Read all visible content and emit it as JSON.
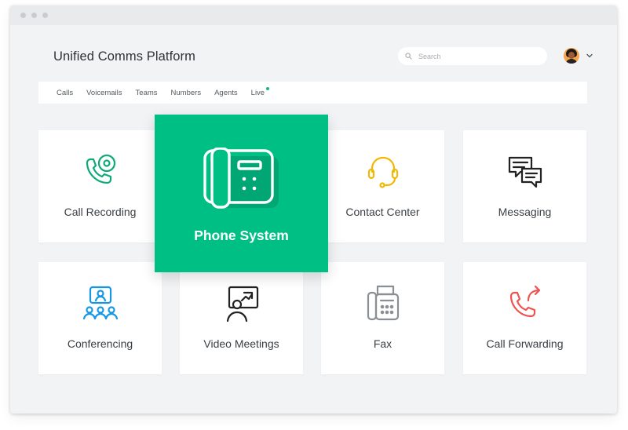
{
  "app": {
    "title": "Unified Comms Platform"
  },
  "search": {
    "placeholder": "Search",
    "value": ""
  },
  "nav": {
    "items": [
      {
        "label": "Calls"
      },
      {
        "label": "Voicemails"
      },
      {
        "label": "Teams"
      },
      {
        "label": "Numbers"
      },
      {
        "label": "Agents"
      },
      {
        "label": "Live",
        "indicator": "live-dot"
      }
    ]
  },
  "colors": {
    "accent": "#00bf85",
    "recording": "#0fa878",
    "contact": "#f2b705",
    "conferencing": "#1597e5",
    "forwarding": "#f0524f",
    "dark_icon": "#222222",
    "gray_icon": "#8a8f94"
  },
  "tiles": {
    "call_recording": {
      "label": "Call Recording",
      "icon": "phone-record-icon"
    },
    "phone_system": {
      "label": "Phone System",
      "icon": "desk-phone-icon"
    },
    "contact_center": {
      "label": "Contact Center",
      "icon": "headset-icon"
    },
    "messaging": {
      "label": "Messaging",
      "icon": "chat-bubbles-icon"
    },
    "conferencing": {
      "label": "Conferencing",
      "icon": "conference-icon"
    },
    "video_meetings": {
      "label": "Video Meetings",
      "icon": "presentation-icon"
    },
    "fax": {
      "label": "Fax",
      "icon": "fax-icon"
    },
    "call_forwarding": {
      "label": "Call Forwarding",
      "icon": "forward-call-icon"
    }
  }
}
